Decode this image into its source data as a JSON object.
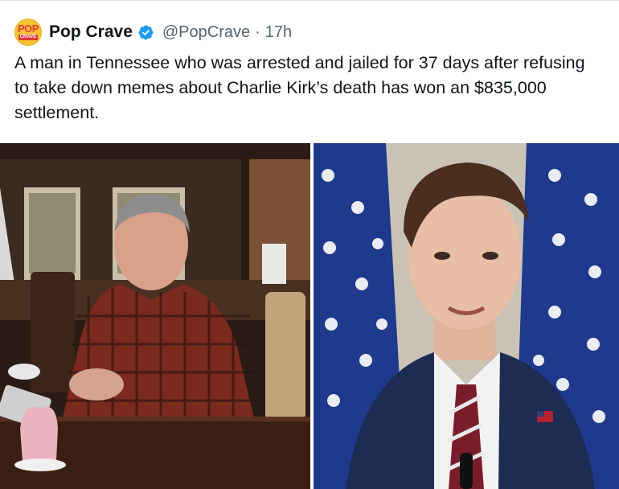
{
  "tweet": {
    "author_name": "Pop Crave",
    "handle": "@PopCrave",
    "separator": "·",
    "time": "17h",
    "text": "A man in Tennessee who was arrested and jailed for 37 days after refusing to take down memes about Charlie Kirk’s death has won an $835,000 settlement.",
    "avatar_logo_text": [
      "POP",
      "CRAVE"
    ],
    "verified_icon": "verified-badge-icon"
  },
  "colors": {
    "verified": "#1d9bf0",
    "muted_text": "#536471",
    "avatar_bg": "#f6c231",
    "avatar_red": "#e23b3b"
  },
  "media": {
    "images": [
      {
        "name": "photo-man-at-table"
      },
      {
        "name": "photo-man-at-podium"
      }
    ]
  }
}
